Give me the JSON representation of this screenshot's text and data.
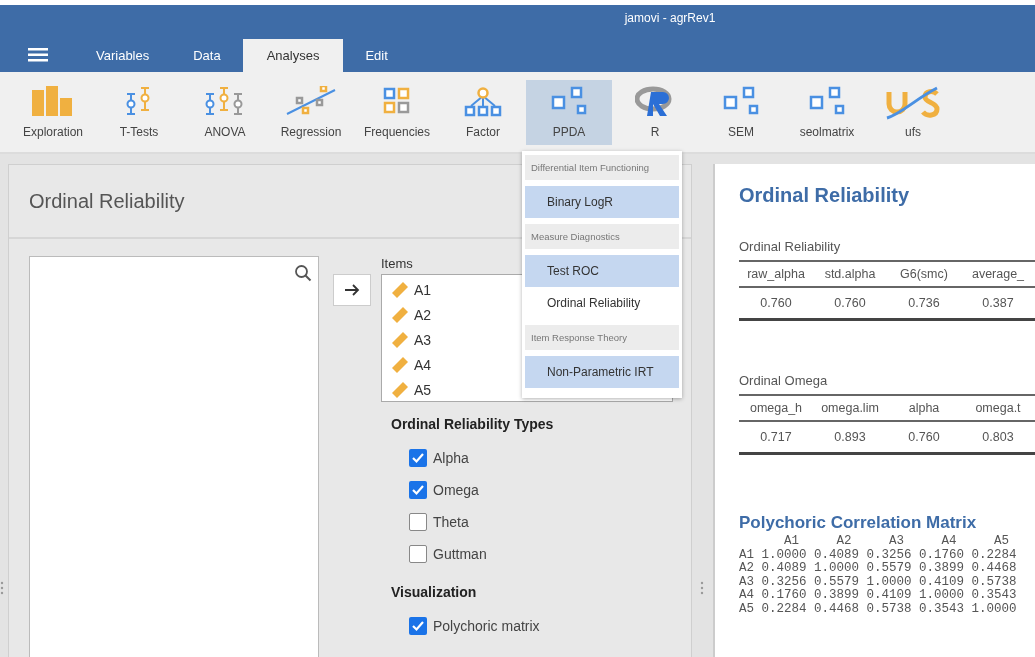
{
  "window": {
    "title": "jamovi - agrRev1"
  },
  "tabs": [
    {
      "label": "Variables",
      "selected": false
    },
    {
      "label": "Data",
      "selected": false
    },
    {
      "label": "Analyses",
      "selected": true
    },
    {
      "label": "Edit",
      "selected": false
    }
  ],
  "toolbar": [
    {
      "label": "Exploration",
      "kind": "bars",
      "selected": false
    },
    {
      "label": "T-Tests",
      "kind": "ttest",
      "selected": false
    },
    {
      "label": "ANOVA",
      "kind": "anova",
      "selected": false
    },
    {
      "label": "Regression",
      "kind": "regression",
      "selected": false
    },
    {
      "label": "Frequencies",
      "kind": "grid",
      "selected": false
    },
    {
      "label": "Factor",
      "kind": "tree",
      "selected": false
    },
    {
      "label": "PPDA",
      "kind": "module",
      "selected": true
    },
    {
      "label": "R",
      "kind": "r",
      "selected": false
    },
    {
      "label": "SEM",
      "kind": "module",
      "selected": false
    },
    {
      "label": "seolmatrix",
      "kind": "module",
      "selected": false
    },
    {
      "label": "ufs",
      "kind": "ufs",
      "selected": false
    }
  ],
  "menu": [
    {
      "header": "Differential Item Functioning",
      "items": [
        {
          "label": "Binary LogR",
          "selected": true
        }
      ]
    },
    {
      "header": "Measure Diagnostics",
      "items": [
        {
          "label": "Test ROC",
          "selected": true
        },
        {
          "label": "Ordinal Reliability",
          "selected": false
        }
      ]
    },
    {
      "header": "Item Response Theory",
      "items": [
        {
          "label": "Non-Parametric IRT",
          "selected": true
        }
      ]
    }
  ],
  "options": {
    "title": "Ordinal Reliability",
    "items_label": "Items",
    "items": [
      "A1",
      "A2",
      "A3",
      "A4",
      "A5"
    ],
    "sections": [
      {
        "title": "Ordinal Reliability Types",
        "checks": [
          {
            "label": "Alpha",
            "checked": true
          },
          {
            "label": "Omega",
            "checked": true
          },
          {
            "label": "Theta",
            "checked": false
          },
          {
            "label": "Guttman",
            "checked": false
          }
        ]
      },
      {
        "title": "Visualization",
        "checks": [
          {
            "label": "Polychoric matrix",
            "checked": true
          }
        ]
      }
    ]
  },
  "results": {
    "title": "Ordinal Reliability",
    "tables": [
      {
        "caption": "Ordinal Reliability",
        "columns": [
          "raw_alpha",
          "std.alpha",
          "G6(smc)",
          "average_"
        ],
        "row": [
          "0.760",
          "0.760",
          "0.736",
          "0.387"
        ]
      },
      {
        "caption": "Ordinal Omega",
        "columns": [
          "omega_h",
          "omega.lim",
          "alpha",
          "omega.t"
        ],
        "row": [
          "0.717",
          "0.893",
          "0.760",
          "0.803"
        ]
      }
    ],
    "matrix_title": "Polychoric Correlation Matrix",
    "matrix": [
      "      A1     A2     A3     A4     A5",
      "A1 1.0000 0.4089 0.3256 0.1760 0.2284",
      "A2 0.4089 1.0000 0.5579 0.3899 0.4468",
      "A3 0.3256 0.5579 1.0000 0.4109 0.5738",
      "A4 0.1760 0.3899 0.4109 1.0000 0.3543",
      "A5 0.2284 0.4468 0.5738 0.3543 1.0000"
    ]
  }
}
